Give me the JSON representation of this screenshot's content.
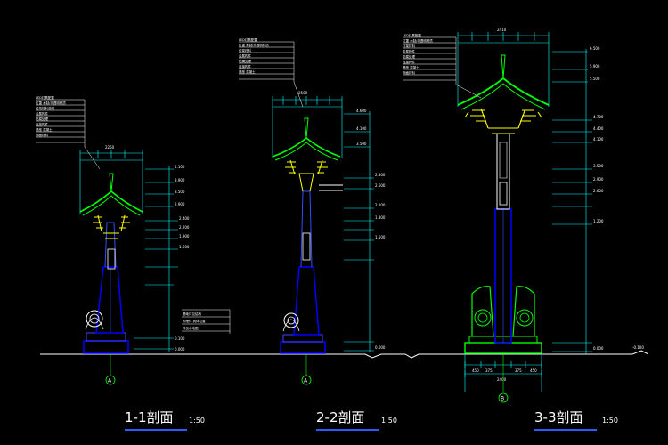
{
  "sections": [
    {
      "title": "1-1剖面",
      "scale": "1:50",
      "axis": "A"
    },
    {
      "title": "2-2剖面",
      "scale": "1:50",
      "axis": "A"
    },
    {
      "title": "3-3剖面",
      "scale": "1:50",
      "axis": "B"
    }
  ],
  "dims": {
    "s3_top_total": "2410",
    "s3_bottom_total": "2400",
    "s3_bottom_parts": [
      "450",
      "375",
      "375",
      "450"
    ],
    "s3_levels": [
      "6.500",
      "5.900",
      "4.700",
      "4.100",
      "3.500",
      "2.900",
      "1.200",
      "0.000",
      "-0.100"
    ],
    "s2_top_total": "2500",
    "s2_levels": [
      "4.600",
      "4.100",
      "3.500",
      "2.800",
      "2.600",
      "2.100",
      "1.800",
      "1.500",
      "0.000"
    ],
    "s1_top_total": "2250",
    "s1_levels": [
      "4.100",
      "3.500",
      "2.900",
      "2.400",
      "2.200",
      "1.900",
      "1.600",
      "0.000"
    ]
  },
  "colors": {
    "outline": "#ffffff",
    "roof": "#00ff00",
    "bracket": "#ffff00",
    "post": "#0000ff",
    "dim": "#00ffff",
    "axis": "#00ff00",
    "title_underline": "#2c5cff"
  }
}
